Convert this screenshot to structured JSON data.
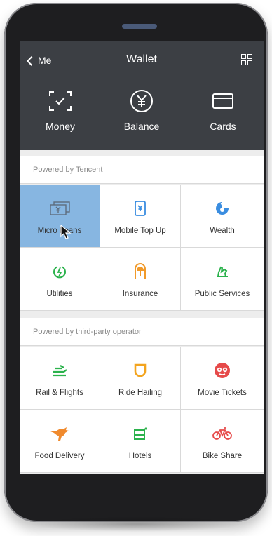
{
  "header": {
    "back_label": "Me",
    "title": "Wallet",
    "top_items": [
      {
        "label": "Money",
        "icon": "scan-check-icon"
      },
      {
        "label": "Balance",
        "icon": "yen-circle-icon"
      },
      {
        "label": "Cards",
        "icon": "card-icon"
      }
    ]
  },
  "sections": [
    {
      "label": "Powered by Tencent",
      "items": [
        {
          "label": "Micro Loans",
          "icon": "banknote-icon",
          "selected": true
        },
        {
          "label": "Mobile Top Up",
          "icon": "phone-yen-icon"
        },
        {
          "label": "Wealth",
          "icon": "wealth-icon"
        },
        {
          "label": "Utilities",
          "icon": "bolt-circle-icon"
        },
        {
          "label": "Insurance",
          "icon": "umbrella-box-icon"
        },
        {
          "label": "Public Services",
          "icon": "hand-icon"
        }
      ]
    },
    {
      "label": "Powered by third-party operator",
      "items": [
        {
          "label": "Rail & Flights",
          "icon": "train-icon"
        },
        {
          "label": "Ride Hailing",
          "icon": "car-u-icon"
        },
        {
          "label": "Movie Tickets",
          "icon": "owl-icon"
        },
        {
          "label": "Food Delivery",
          "icon": "kangaroo-icon"
        },
        {
          "label": "Hotels",
          "icon": "bed-icon"
        },
        {
          "label": "Bike Share",
          "icon": "bike-icon"
        }
      ]
    }
  ],
  "colors": {
    "header_bg": "#3c3f44",
    "selected_bg": "#87b6e1",
    "utilities": "#2bb24c",
    "insurance": "#f19a2a",
    "public_services": "#2bb24c",
    "rail": "#2bb24c",
    "ride": "#f3a41e",
    "movie": "#e64a4a",
    "food": "#f08a2d",
    "hotels": "#2bb24c",
    "bike": "#e64a4a",
    "wealth": "#3a8de0",
    "blue": "#3a8de0"
  }
}
